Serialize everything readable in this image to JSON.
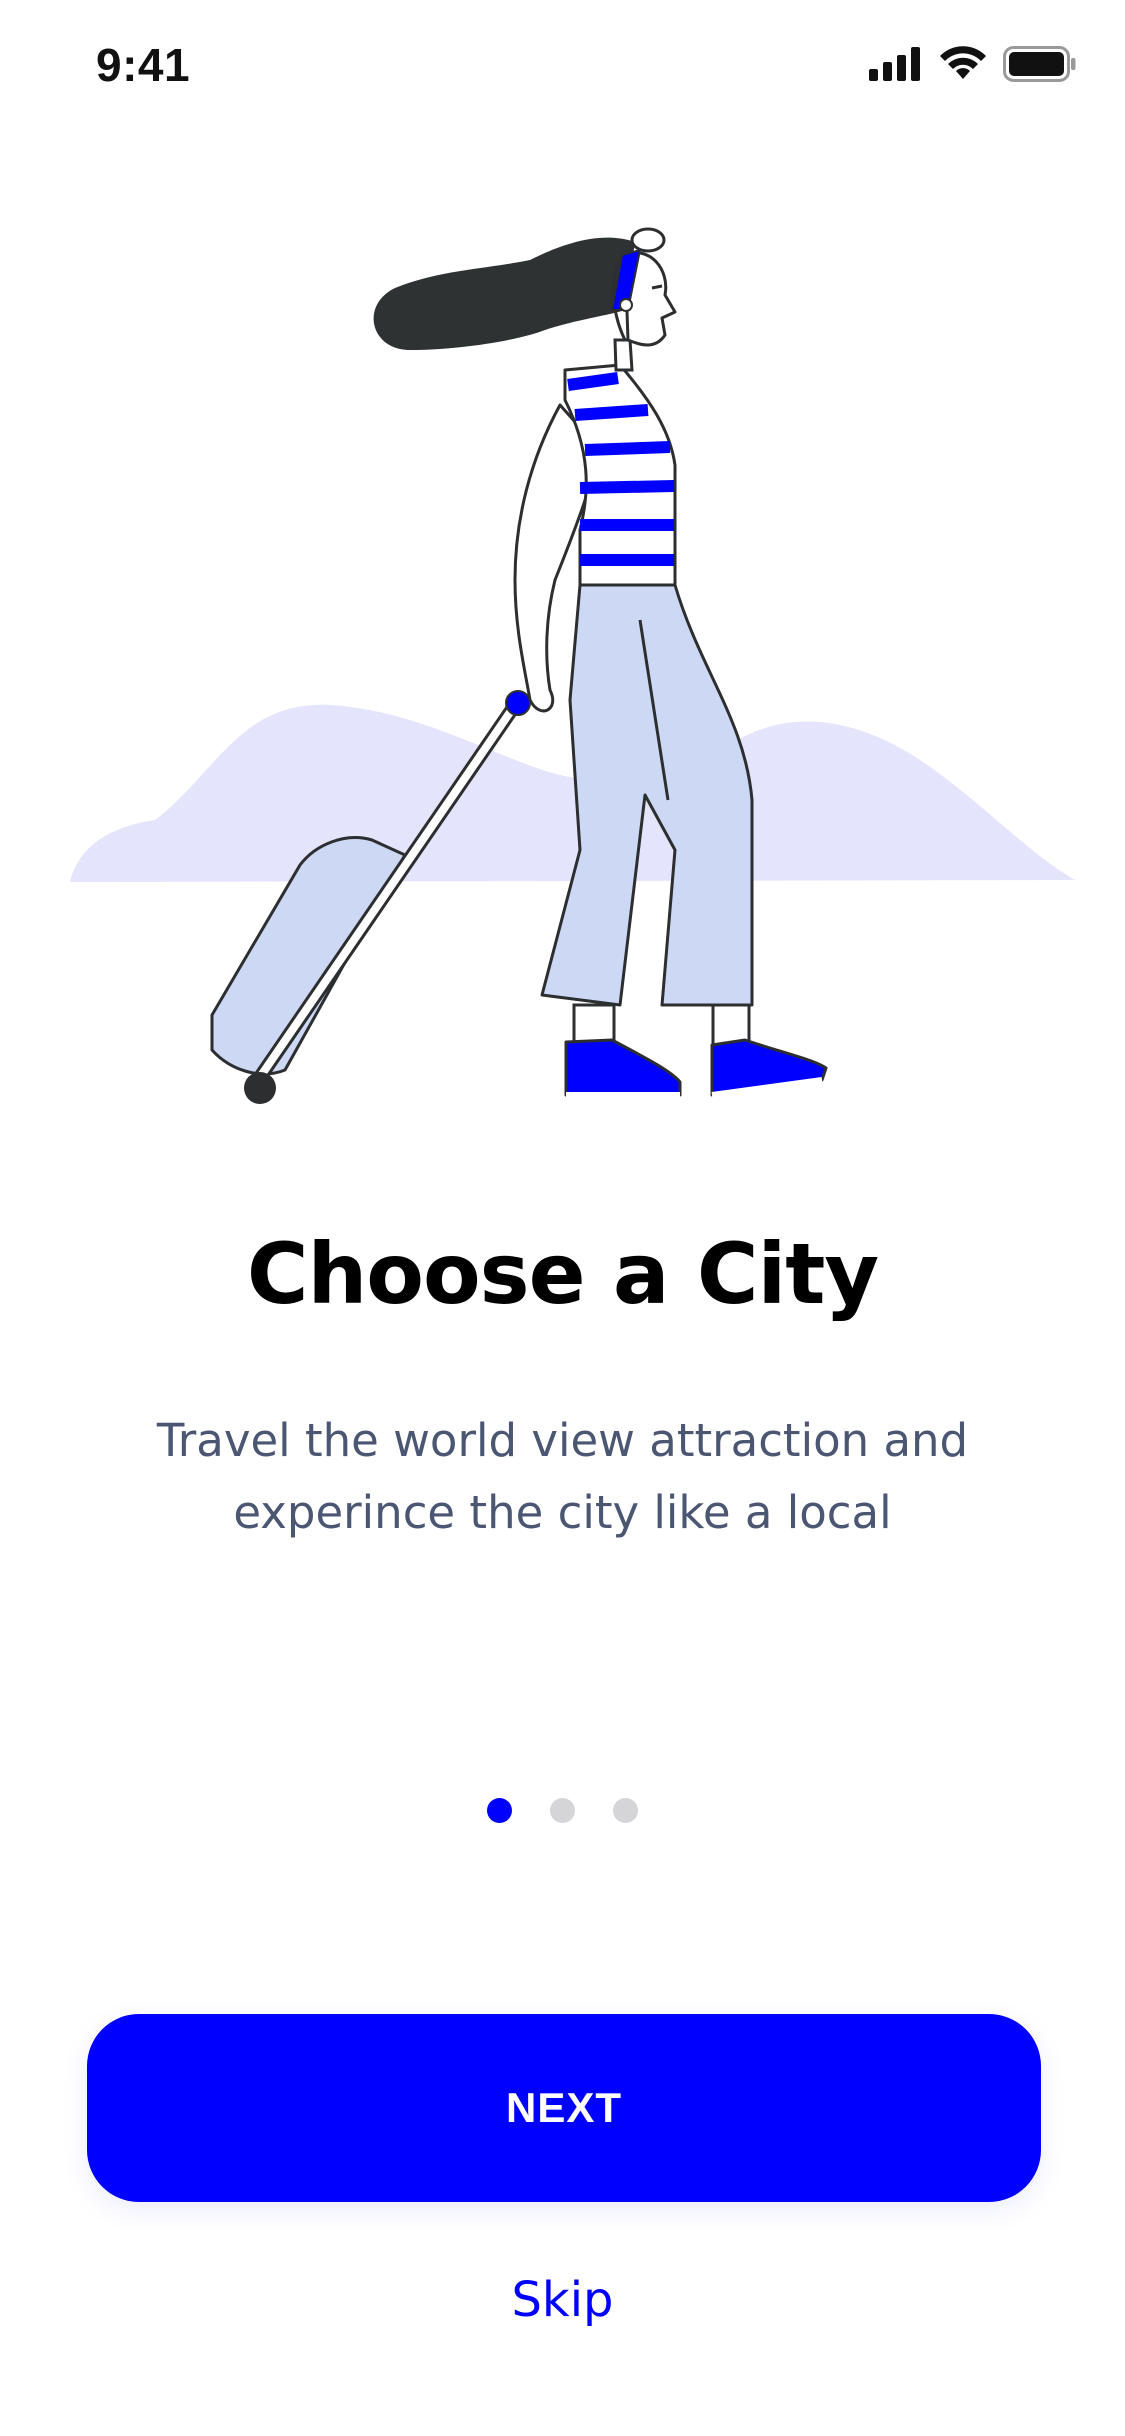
{
  "status_bar": {
    "time": "9:41",
    "icons": [
      "cellular-signal-icon",
      "wifi-icon",
      "battery-icon"
    ]
  },
  "illustration": {
    "name": "woman-walking-with-suitcase-illustration"
  },
  "onboarding": {
    "title": "Choose a City",
    "subtitle": "Travel the world view attraction and experince the city like a local",
    "page_count": 3,
    "current_page": 1
  },
  "actions": {
    "next_label": "NEXT",
    "skip_label": "Skip"
  },
  "colors": {
    "accent": "#0000FF",
    "subtitle_text": "#4B5672",
    "dot_inactive": "#D5D5D8",
    "hill": "#E4E4FC",
    "pants": "#CCD8F4"
  }
}
